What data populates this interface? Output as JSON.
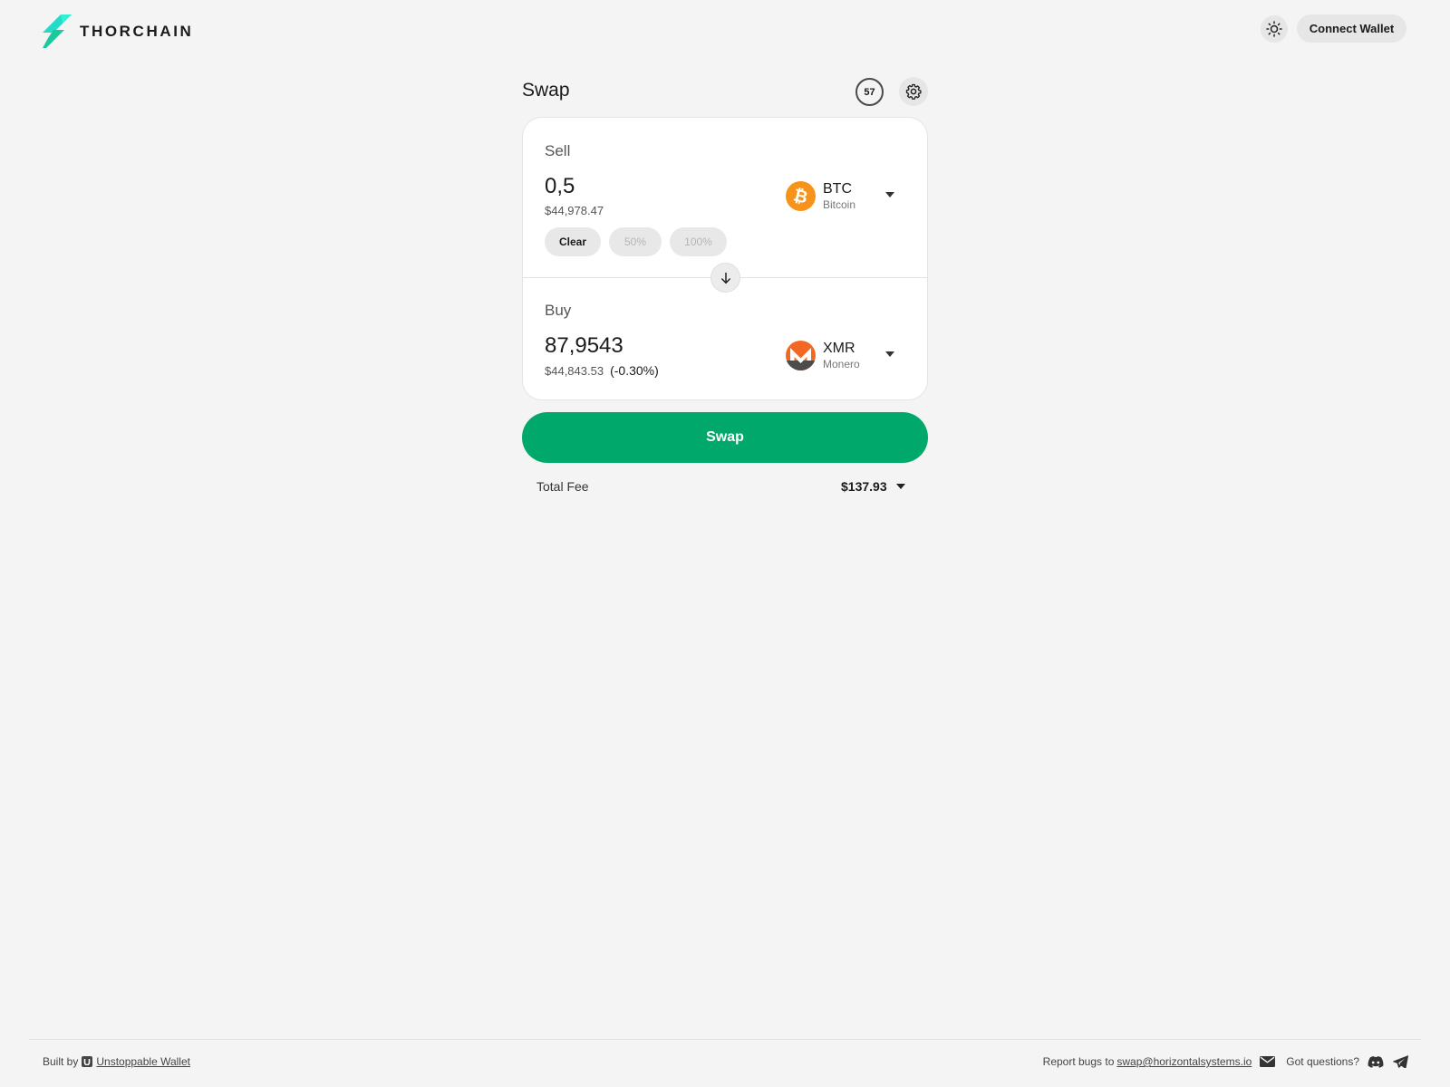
{
  "header": {
    "brand": "THORCHAIN",
    "connect_label": "Connect Wallet",
    "theme_icon": "sun-icon"
  },
  "swap": {
    "title": "Swap",
    "timer": "57",
    "sell": {
      "label": "Sell",
      "amount": "0,5",
      "usd": "$44,978.47",
      "chips": [
        "Clear",
        "50%",
        "100%"
      ],
      "token_symbol": "BTC",
      "token_name": "Bitcoin"
    },
    "buy": {
      "label": "Buy",
      "amount": "87,9543",
      "usd": "$44,843.53",
      "diff": "(-0.30%)",
      "token_symbol": "XMR",
      "token_name": "Monero"
    },
    "button_label": "Swap",
    "fee_label": "Total Fee",
    "fee_value": "$137.93"
  },
  "colors": {
    "accent": "#00a86b",
    "btc": "#f7931a",
    "xmr": "#f26822",
    "brand_teal": "#23dcc8"
  },
  "footer": {
    "built_by": "Built by",
    "built_by_link": "Unstoppable Wallet",
    "report_bugs": "Report bugs to",
    "email": "swap@horizontalsystems.io",
    "questions": "Got questions?"
  }
}
